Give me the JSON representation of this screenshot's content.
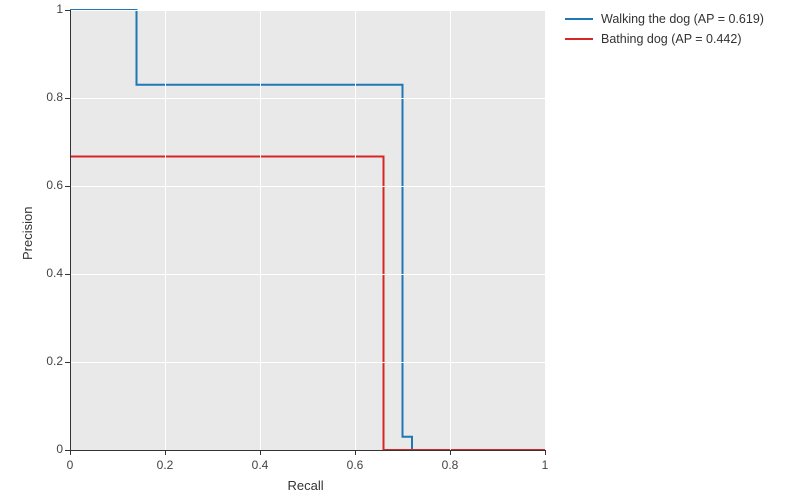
{
  "chart_data": {
    "type": "line",
    "xlabel": "Recall",
    "ylabel": "Precision",
    "xlim": [
      0,
      1
    ],
    "ylim": [
      0,
      1
    ],
    "xticks": [
      0,
      0.2,
      0.4,
      0.6,
      0.8,
      1
    ],
    "yticks": [
      0,
      0.2,
      0.4,
      0.6,
      0.8,
      1
    ],
    "legend_position": "right",
    "series": [
      {
        "name": "Walking the dog (AP = 0.619)",
        "color": "#1f77b4",
        "x": [
          0.0,
          0.14,
          0.14,
          0.7,
          0.7,
          0.72,
          0.72,
          1.0
        ],
        "y": [
          1.0,
          1.0,
          0.83,
          0.83,
          0.03,
          0.03,
          0.0,
          0.0
        ]
      },
      {
        "name": "Bathing dog (AP = 0.442)",
        "color": "#d62728",
        "x": [
          0.0,
          0.66,
          0.66,
          1.0
        ],
        "y": [
          0.667,
          0.667,
          0.0,
          0.0
        ]
      }
    ]
  }
}
